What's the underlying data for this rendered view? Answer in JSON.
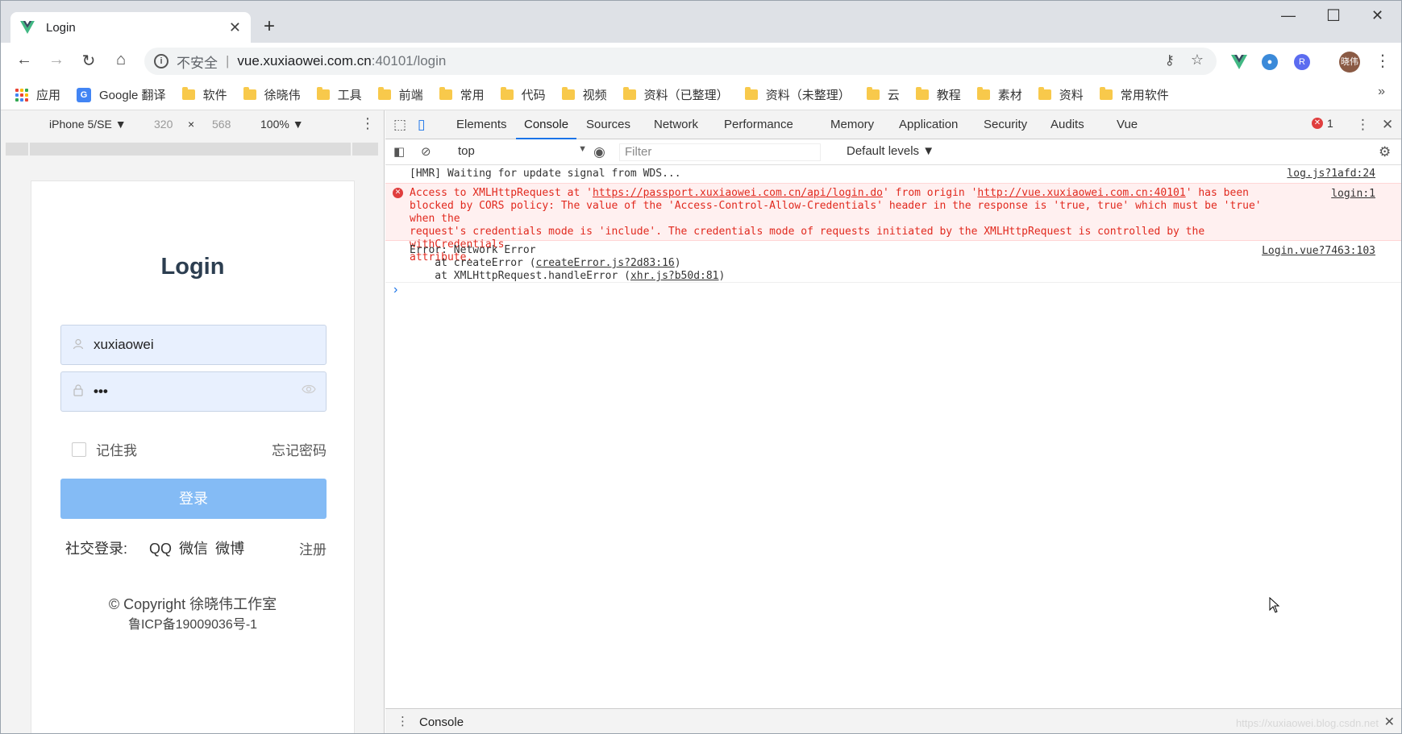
{
  "browser": {
    "tab_title": "Login",
    "new_tab": "+",
    "url_insecure": "不安全",
    "url_sep": "|",
    "url_host": "vue.xuxiaowei.com.cn",
    "url_path": ":40101/login",
    "profile_initials": "晓伟",
    "ext_r": "R"
  },
  "bookmarks": {
    "items": [
      "应用",
      "Google 翻译",
      "软件",
      "徐晓伟",
      "工具",
      "前端",
      "常用",
      "代码",
      "视频",
      "资料（已整理）",
      "资料（未整理）",
      "云",
      "教程",
      "素材",
      "资料",
      "常用软件"
    ],
    "more": "»"
  },
  "device": {
    "name": "iPhone 5/SE ▼",
    "width": "320",
    "times": "×",
    "height": "568",
    "zoom": "100% ▼"
  },
  "login": {
    "title": "Login",
    "username": "xuxiaowei",
    "password": "•••",
    "remember": "记住我",
    "forgot": "忘记密码",
    "submit": "登录",
    "social_label": "社交登录:",
    "social_qq": "QQ",
    "social_wechat": "微信",
    "social_weibo": "微博",
    "register": "注册",
    "copyright_line1": "© Copyright 徐晓伟工作室",
    "copyright_line2": "鲁ICP备19009036号-1"
  },
  "devtools": {
    "tabs": [
      "Elements",
      "Console",
      "Sources",
      "Network",
      "Performance",
      "Memory",
      "Application",
      "Security",
      "Audits",
      "Vue"
    ],
    "active_tab": "Console",
    "error_count": "1",
    "context": "top",
    "filter_placeholder": "Filter",
    "levels": "Default levels ▼",
    "drawer_tab": "Console"
  },
  "console": {
    "hmr_msg": "[HMR] Waiting for update signal from WDS...",
    "hmr_src": "log.js?1afd:24",
    "cors_line1_a": "Access to XMLHttpRequest at '",
    "cors_url1": "https://passport.xuxiaowei.com.cn/api/login.do",
    "cors_line1_b": "' from origin '",
    "cors_url2": "http://vue.xuxiaowei.com.cn:40101",
    "cors_line1_c": "' has been",
    "cors_line2": "blocked by CORS policy: The value of the 'Access-Control-Allow-Credentials' header in the response is 'true, true' which must be 'true' when the",
    "cors_line3": "request's credentials mode is 'include'. The credentials mode of requests initiated by the XMLHttpRequest is controlled by the withCredentials",
    "cors_line4": "attribute.",
    "cors_src": "login:1",
    "err_line1": "Error: Network Error",
    "err_line2_a": "    at createError (",
    "err_line2_link": "createError.js?2d83:16",
    "err_line2_b": ")",
    "err_line3_a": "    at XMLHttpRequest.handleError (",
    "err_line3_link": "xhr.js?b50d:81",
    "err_line3_b": ")",
    "err_src": "Login.vue?7463:103",
    "prompt": "›"
  },
  "watermark": "https://xuxiaowei.blog.csdn.net",
  "colors": {
    "accent": "#1a73e8",
    "error_text": "#e1291e",
    "login_button": "#84bbf5",
    "input_bg": "#e8f0fe"
  }
}
